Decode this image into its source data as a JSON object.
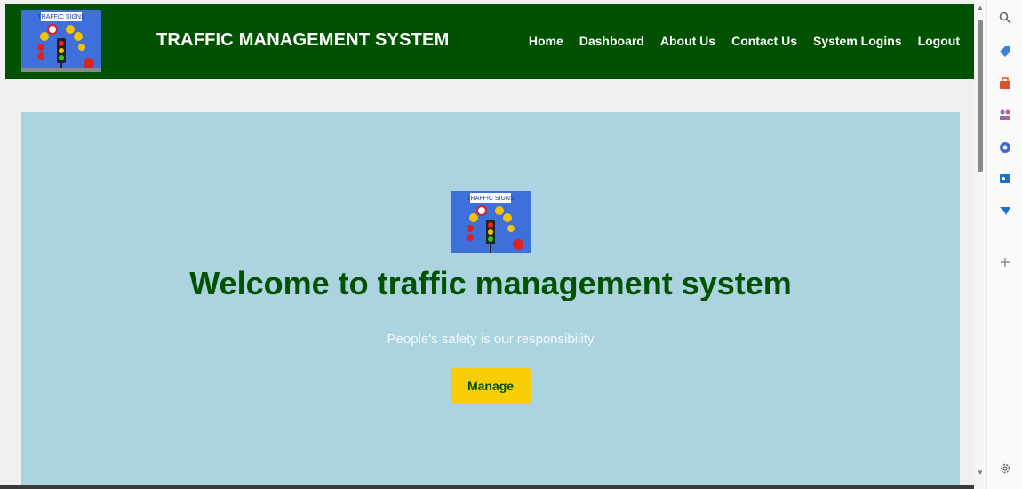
{
  "navbar": {
    "title": "TRAFFIC MANAGEMENT SYSTEM",
    "links": [
      {
        "label": "Home"
      },
      {
        "label": "Dashboard"
      },
      {
        "label": "About Us"
      },
      {
        "label": "Contact Us"
      },
      {
        "label": "System Logins"
      },
      {
        "label": "Logout"
      }
    ]
  },
  "logo": {
    "text": "TRAFFIC SIGNS"
  },
  "hero": {
    "title": "Welcome to traffic management system",
    "subtitle": "People's safety is our responsibility",
    "button_label": "Manage"
  },
  "sidebar": {
    "icons": [
      "search-icon",
      "tag-icon",
      "toolbox-icon",
      "people-icon",
      "office-icon",
      "outlook-icon",
      "send-icon",
      "add-icon",
      "settings-icon"
    ]
  },
  "colors": {
    "navbar": "#005200",
    "hero_bg": "#abd4e0",
    "title": "#005200",
    "button": "#f9cd07"
  }
}
